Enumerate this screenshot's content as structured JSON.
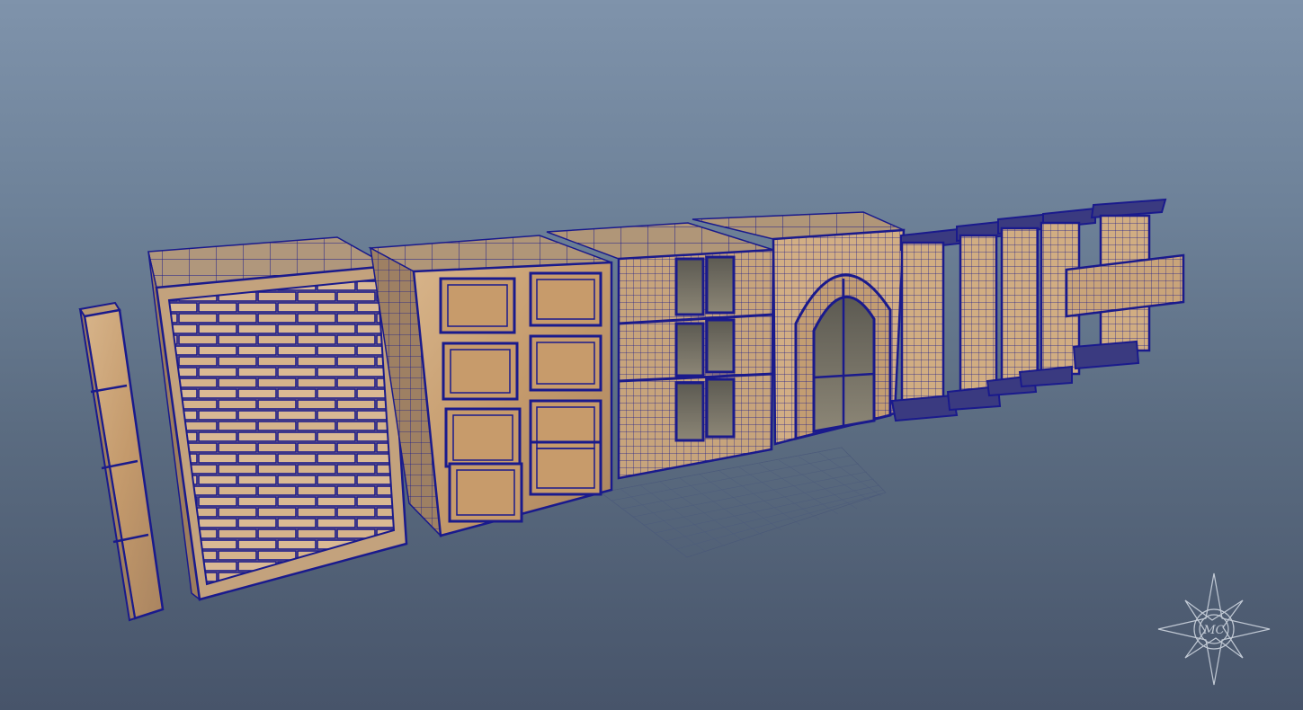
{
  "viewport": {
    "background_top": "#7f93ab",
    "background_bottom": "#47546a",
    "wire_color": "#1a1a8c",
    "texture_color": "#c9a277"
  },
  "watermark": {
    "monogram": "MC"
  }
}
